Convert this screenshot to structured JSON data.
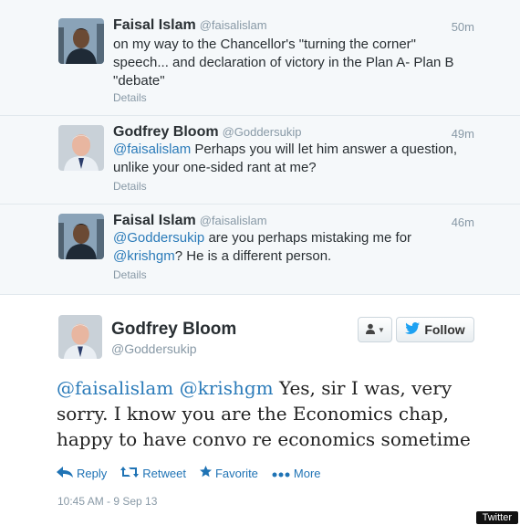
{
  "thread": [
    {
      "name": "Faisal Islam",
      "handle": "@faisalislam",
      "time": "50m",
      "text": "on my way to the Chancellor's \"turning the corner\" speech... and declaration of victory in the Plan A- Plan B \"debate\"",
      "details": "Details"
    },
    {
      "name": "Godfrey Bloom",
      "handle": "@Goddersukip",
      "time": "49m",
      "mention": "@faisalislam",
      "text": " Perhaps you will let him answer a question, unlike your one-sided rant at me?",
      "details": "Details"
    },
    {
      "name": "Faisal Islam",
      "handle": "@faisalislam",
      "time": "46m",
      "mention1": "@Goddersukip",
      "text1": " are you perhaps mistaking me for ",
      "mention2": "@krishgm",
      "text2": "? He is a different person.",
      "details": "Details"
    }
  ],
  "main": {
    "name": "Godfrey Bloom",
    "handle": "@Goddersukip",
    "follow_label": "Follow",
    "mention1": "@faisalislam",
    "mention2": "@krishgm",
    "text": " Yes, sir I was, very sorry. I know you are the Economics chap, happy to have convo re economics sometime",
    "actions": {
      "reply": "Reply",
      "retweet": "Retweet",
      "favorite": "Favorite",
      "more": "More"
    },
    "timestamp": "10:45 AM - 9 Sep 13"
  },
  "credit": "Twitter",
  "colors": {
    "link": "#2b7bb9",
    "action": "#1f73b5",
    "bird": "#1da1f2"
  }
}
